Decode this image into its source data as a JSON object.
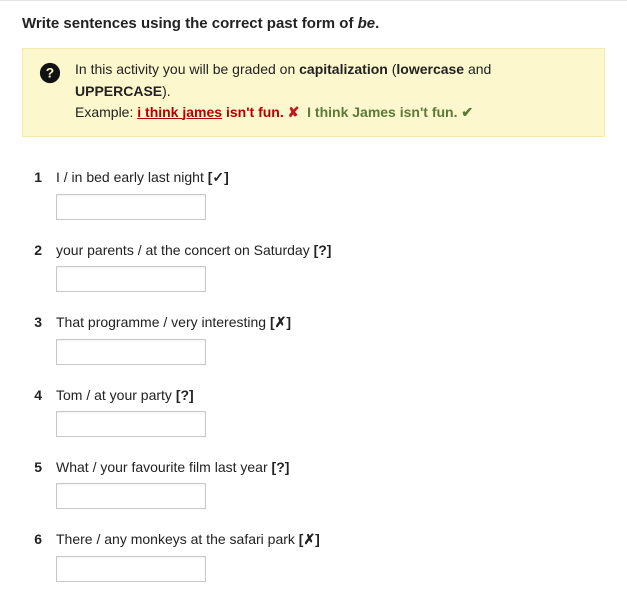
{
  "instruction_prefix": "Write sentences using the correct past form of ",
  "instruction_em": "be",
  "instruction_suffix": ".",
  "hint": {
    "line1_a": "In this activity you will be graded on ",
    "line1_b": "capitalization",
    "line1_c": " (",
    "line1_d": "lowercase",
    "line1_e": " and ",
    "line1_f": "UPPERCASE",
    "line1_g": ").",
    "example_label": "Example: ",
    "wrong_part1": "i think ",
    "wrong_part2": "james",
    "wrong_part3": " isn't fun.",
    "cross": "✘",
    "right": "I think James isn't fun.",
    "check": "✔"
  },
  "questions": [
    {
      "num": "1",
      "prompt": "I / in bed early last night ",
      "marker": "[✓]",
      "value": ""
    },
    {
      "num": "2",
      "prompt": "your parents / at the concert on Saturday ",
      "marker": "[?]",
      "value": ""
    },
    {
      "num": "3",
      "prompt": "That programme / very interesting ",
      "marker": "[✗]",
      "value": ""
    },
    {
      "num": "4",
      "prompt": "Tom / at your party ",
      "marker": "[?]",
      "value": ""
    },
    {
      "num": "5",
      "prompt": "What / your favourite film last year ",
      "marker": "[?]",
      "value": ""
    },
    {
      "num": "6",
      "prompt": "There / any monkeys at the safari park ",
      "marker": "[✗]",
      "value": ""
    }
  ]
}
